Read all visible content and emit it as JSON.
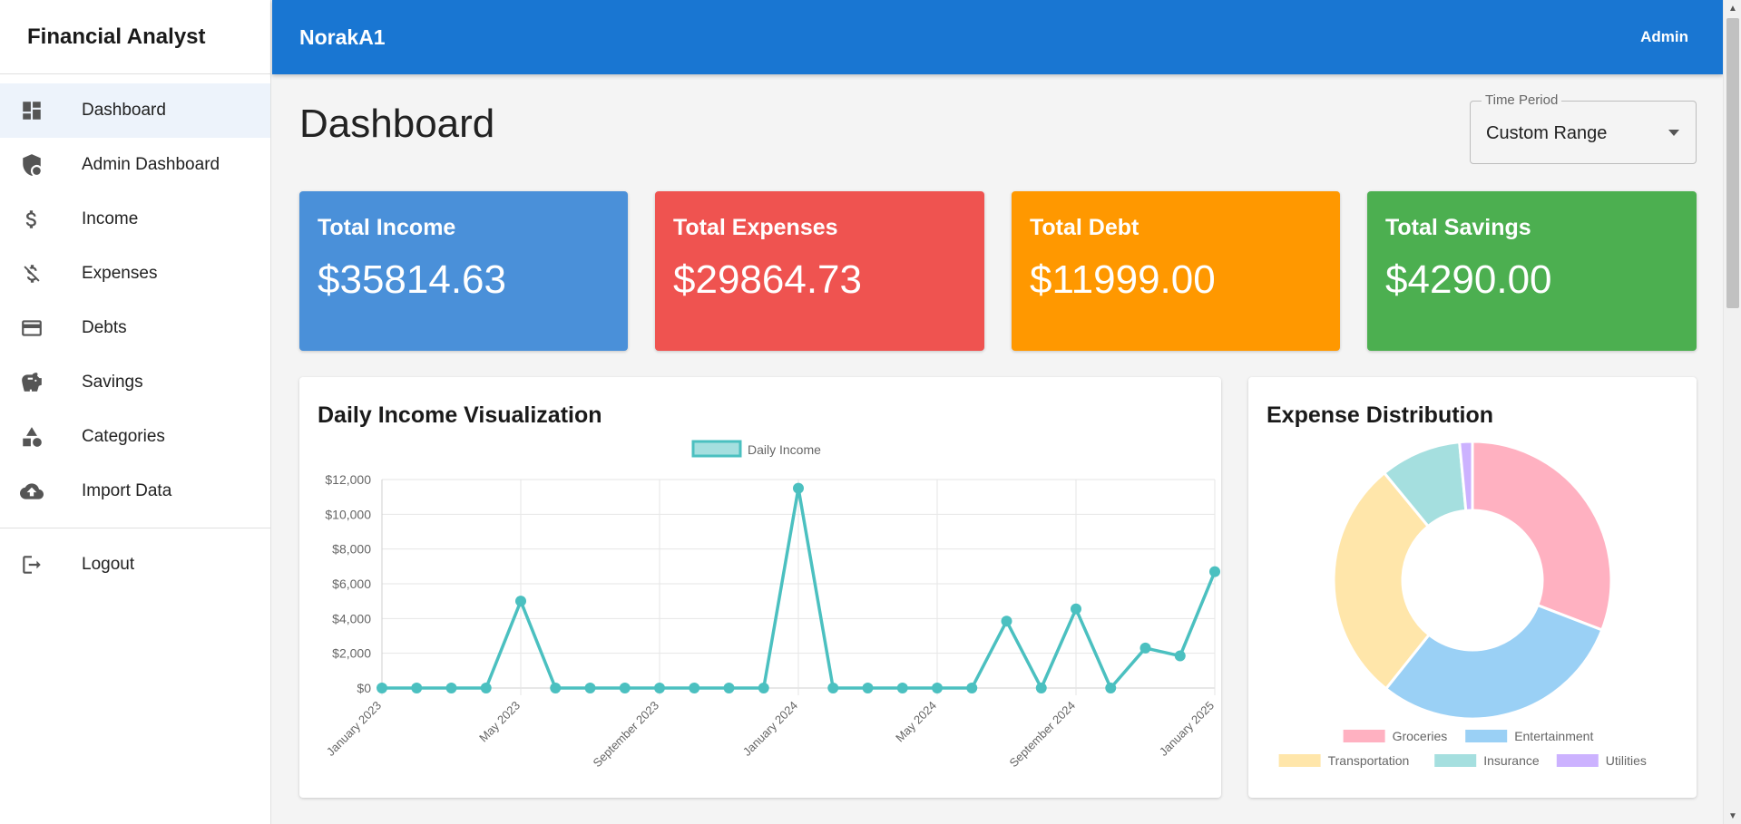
{
  "sidebar": {
    "brand": "Financial Analyst",
    "items": [
      {
        "label": "Dashboard",
        "icon": "dashboard-icon"
      },
      {
        "label": "Admin Dashboard",
        "icon": "admin-shield-icon"
      },
      {
        "label": "Income",
        "icon": "dollar-icon"
      },
      {
        "label": "Expenses",
        "icon": "money-off-icon"
      },
      {
        "label": "Debts",
        "icon": "credit-card-icon"
      },
      {
        "label": "Savings",
        "icon": "piggy-bank-icon"
      },
      {
        "label": "Categories",
        "icon": "categories-icon"
      },
      {
        "label": "Import Data",
        "icon": "cloud-upload-icon"
      }
    ],
    "logout": {
      "label": "Logout",
      "icon": "logout-icon"
    }
  },
  "header": {
    "title": "NorakA1",
    "user": "Admin",
    "color": "#1976d2"
  },
  "page": {
    "title": "Dashboard"
  },
  "time_period": {
    "label": "Time Period",
    "value": "Custom Range"
  },
  "cards": [
    {
      "title": "Total Income",
      "value": "$35814.63",
      "color": "#4a90d9"
    },
    {
      "title": "Total Expenses",
      "value": "$29864.73",
      "color": "#ef5350"
    },
    {
      "title": "Total Debt",
      "value": "$11999.00",
      "color": "#ff9800"
    },
    {
      "title": "Total Savings",
      "value": "$4290.00",
      "color": "#4caf50"
    }
  ],
  "income_panel": {
    "title": "Daily Income Visualization"
  },
  "expense_panel": {
    "title": "Expense Distribution"
  },
  "chart_data": [
    {
      "type": "line",
      "title": "",
      "xlabel": "",
      "ylabel": "",
      "ylim": [
        0,
        12000
      ],
      "yticks": [
        "$0",
        "$2,000",
        "$4,000",
        "$6,000",
        "$8,000",
        "$10,000",
        "$12,000"
      ],
      "xtick_labels": [
        "January 2023",
        "May 2023",
        "September 2023",
        "January 2024",
        "May 2024",
        "September 2024",
        "January 2025"
      ],
      "x": [
        "2023-01",
        "2023-02",
        "2023-03",
        "2023-04",
        "2023-05",
        "2023-06",
        "2023-07",
        "2023-08",
        "2023-09",
        "2023-10",
        "2023-11",
        "2023-12",
        "2024-01",
        "2024-02",
        "2024-03",
        "2024-04",
        "2024-05",
        "2024-06",
        "2024-07",
        "2024-08",
        "2024-09",
        "2024-10",
        "2024-11",
        "2024-12",
        "2025-01"
      ],
      "series": [
        {
          "name": "Daily Income",
          "color": "#4bc0c0",
          "values": [
            0,
            0,
            0,
            0,
            5000,
            0,
            0,
            0,
            0,
            0,
            0,
            0,
            11500,
            0,
            0,
            0,
            0,
            0,
            3850,
            0,
            4550,
            0,
            2300,
            1850,
            6700
          ]
        }
      ],
      "legend": "top",
      "grid": true
    },
    {
      "type": "pie",
      "variant": "doughnut",
      "labels": [
        "Groceries",
        "Entertainment",
        "Transportation",
        "Insurance",
        "Utilities"
      ],
      "values": [
        31,
        30,
        28.5,
        9.5,
        1.5
      ],
      "colors": [
        "#ffb1c1",
        "#9ad0f5",
        "#ffe6aa",
        "#a5dfdf",
        "#ccb2ff"
      ],
      "legend": "bottom"
    }
  ]
}
